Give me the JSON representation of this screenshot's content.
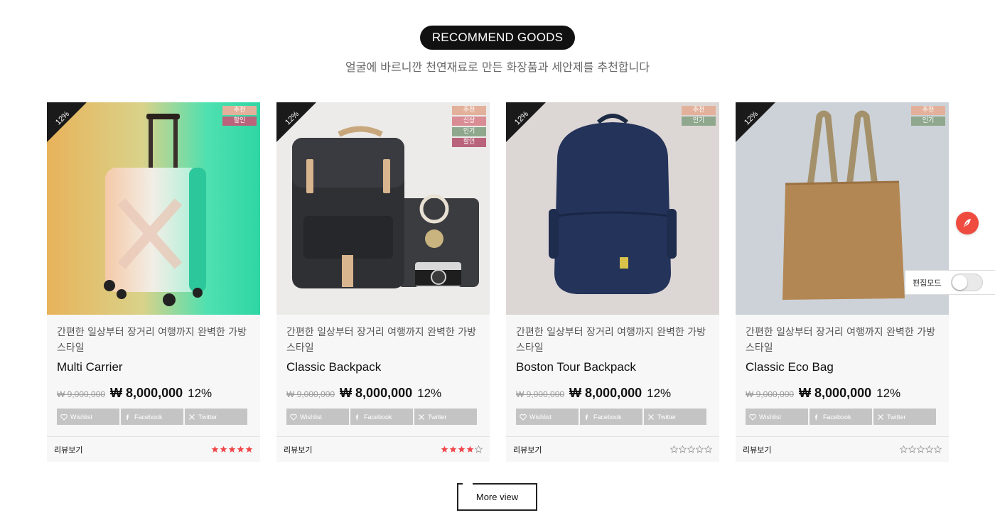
{
  "section": {
    "title": "RECOMMEND GOODS",
    "subtitle": "얼굴에 바르니깐 천연재료로 만든 화장품과 세안제를 추천합니다"
  },
  "colors": {
    "badge_recommend": "#e3b19b",
    "badge_new": "#d98c94",
    "badge_popular": "#8fa88d",
    "badge_sale": "#b9647a",
    "star_filled": "#f0494d",
    "star_empty": "#9a9a9a",
    "fab": "#ef4b3f"
  },
  "share_labels": {
    "wishlist": "Wishlist",
    "facebook": "Facebook",
    "twitter": "Twitter"
  },
  "products": [
    {
      "discount_tag": "12%",
      "badges": [
        "추천",
        "할인"
      ],
      "image": "suitcase",
      "description": "간편한 일상부터 장거리 여행까지 완벽한 가방 스타일",
      "name": "Multi Carrier",
      "old_price": "₩ 9,000,000",
      "price": "₩ 8,000,000",
      "discount": "12%",
      "review_label": "리뷰보기",
      "rating": 5
    },
    {
      "discount_tag": "12%",
      "badges": [
        "추천",
        "신상",
        "인기",
        "할인"
      ],
      "image": "backpack-camera",
      "description": "간편한 일상부터 장거리 여행까지 완벽한 가방 스타일",
      "name": "Classic Backpack",
      "old_price": "₩ 9,000,000",
      "price": "₩ 8,000,000",
      "discount": "12%",
      "review_label": "리뷰보기",
      "rating": 4
    },
    {
      "discount_tag": "12%",
      "badges": [
        "추천",
        "인기"
      ],
      "image": "navy-backpack",
      "description": "간편한 일상부터 장거리 여행까지 완벽한 가방 스타일",
      "name": "Boston Tour Backpack",
      "old_price": "₩ 9,000,000",
      "price": "₩ 8,000,000",
      "discount": "12%",
      "review_label": "리뷰보기",
      "rating": 0
    },
    {
      "discount_tag": "12%",
      "badges": [
        "추천",
        "인기"
      ],
      "image": "eco-bag",
      "description": "간편한 일상부터 장거리 여행까지 완벽한 가방 스타일",
      "name": "Classic Eco Bag",
      "old_price": "₩ 9,000,000",
      "price": "₩ 8,000,000",
      "discount": "12%",
      "review_label": "리뷰보기",
      "rating": 0
    }
  ],
  "more_button": "More view",
  "edit_mode": {
    "label": "편집모드",
    "enabled": false
  }
}
